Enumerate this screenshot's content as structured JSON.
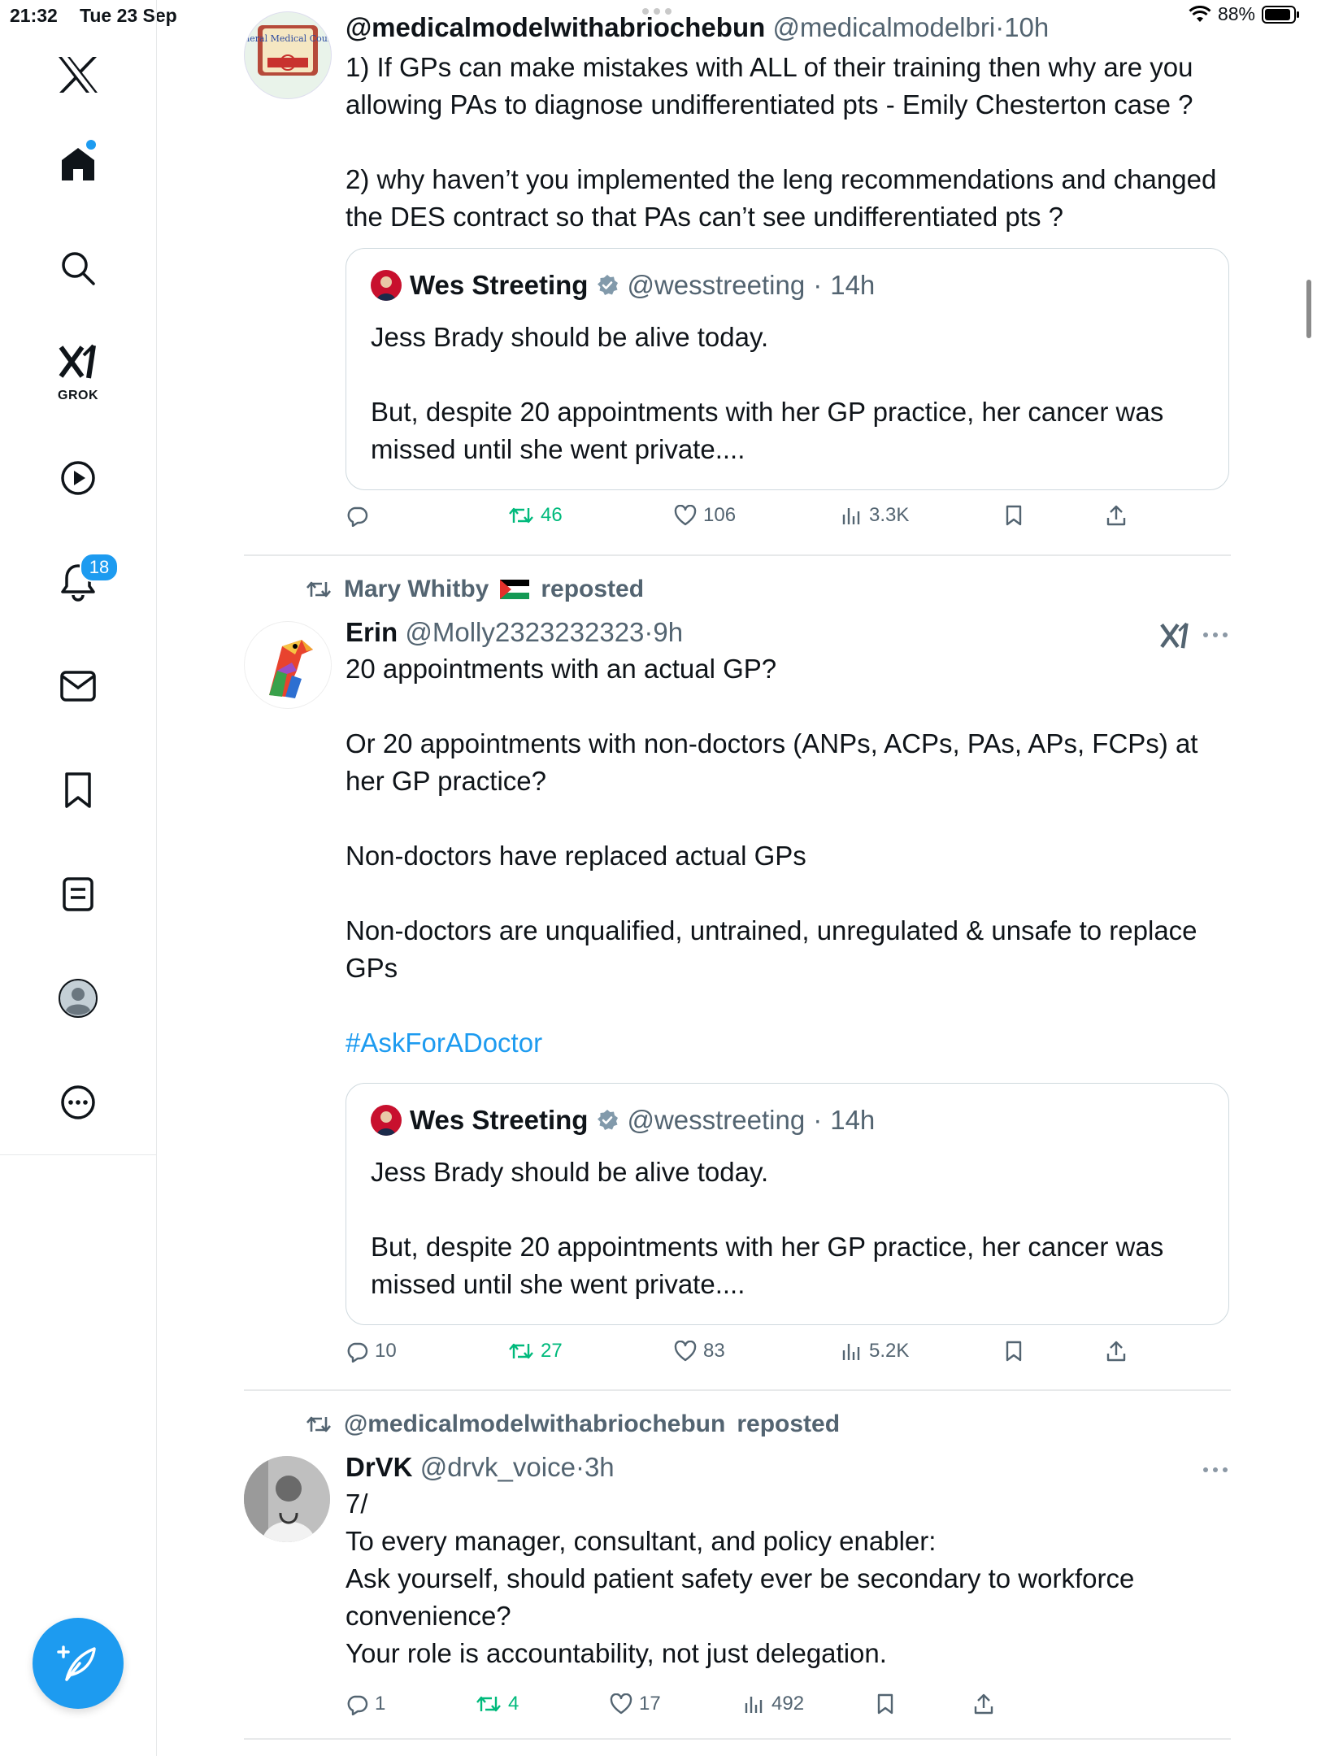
{
  "status_bar": {
    "time": "21:32",
    "date": "Tue 23 Sep",
    "battery": "88%"
  },
  "sidebar": {
    "items": [
      {
        "name": "x-logo-icon"
      },
      {
        "name": "home-icon"
      },
      {
        "name": "search-icon"
      },
      {
        "name": "grok-icon",
        "label": "GROK"
      },
      {
        "name": "video-icon"
      },
      {
        "name": "notifications-icon",
        "badge": "18"
      },
      {
        "name": "messages-icon"
      },
      {
        "name": "bookmarks-icon"
      },
      {
        "name": "lists-icon"
      },
      {
        "name": "profile-icon"
      },
      {
        "name": "more-icon"
      }
    ],
    "compose_icon": "compose-icon"
  },
  "colors": {
    "accent": "#1d9bf0",
    "repost": "#00ba7c",
    "muted": "#536471",
    "text": "#0f1419"
  },
  "posts": [
    {
      "name": "@medicalmodelwithabriochebun",
      "handle": "@medicalmodelbri",
      "sep": "·",
      "time": "10h",
      "text": "1) If GPs can make mistakes with ALL of their training then why are you allowing PAs to diagnose undifferentiated pts - Emily Chesterton case ?\n\n2) why haven’t you implemented the leng recommendations and changed the DES contract so that PAs can’t see undifferentiated pts ?",
      "avatar_text": "General Medical Council",
      "quote": {
        "name": "Wes Streeting",
        "handle": "@wesstreeting",
        "sep": "·",
        "time": "14h",
        "text": "Jess Brady should be alive today.\n\nBut, despite 20 appointments with her GP practice, her cancer was missed until she went private...."
      },
      "actions": {
        "replies": "",
        "reposts": "46",
        "likes": "106",
        "views": "3.3K"
      }
    },
    {
      "repost_by": "Mary Whitby",
      "repost_suffix": "reposted",
      "name": "Erin",
      "handle": "@Molly2323232323",
      "sep": "·",
      "time": "9h",
      "text": "20 appointments with an actual GP?\n\nOr 20 appointments with non-doctors (ANPs, ACPs, PAs, APs, FCPs) at her GP practice?\n\nNon-doctors have replaced actual GPs\n\nNon-doctors are unqualified, untrained, unregulated & unsafe to replace GPs\n\n",
      "hashtag": "#AskForADoctor",
      "quote": {
        "name": "Wes Streeting",
        "handle": "@wesstreeting",
        "sep": "·",
        "time": "14h",
        "text": "Jess Brady should be alive today.\n\nBut, despite 20 appointments with her GP practice, her cancer was missed until she went private...."
      },
      "actions": {
        "replies": "10",
        "reposts": "27",
        "likes": "83",
        "views": "5.2K"
      }
    },
    {
      "repost_by": "@medicalmodelwithabriochebun",
      "repost_suffix": "reposted",
      "name": "DrVK",
      "handle": "@drvk_voice",
      "sep": "·",
      "time": "3h",
      "text": "7/\nTo every manager, consultant, and policy enabler:\nAsk yourself, should patient safety ever be secondary to workforce convenience?\nYour role is accountability, not just delegation.",
      "actions": {
        "replies": "1",
        "reposts": "4",
        "likes": "17",
        "views": "492"
      }
    }
  ]
}
